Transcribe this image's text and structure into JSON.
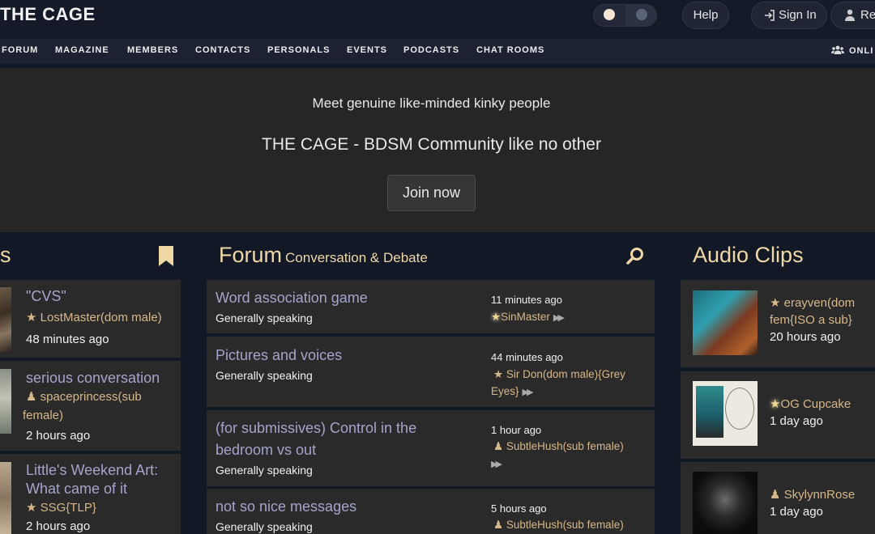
{
  "header": {
    "logo": "THE CAGE",
    "help_label": "Help",
    "signin_label": "Sign In",
    "register_label": "Re"
  },
  "nav": {
    "items": [
      "FORUM",
      "MAGAZINE",
      "MEMBERS",
      "CONTACTS",
      "PERSONALS",
      "EVENTS",
      "PODCASTS",
      "CHAT ROOMS"
    ],
    "online_label": "ONLI"
  },
  "hero": {
    "tagline": "Meet genuine like-minded kinky people",
    "title": "THE CAGE - BDSM Community like no other",
    "join_label": "Join now"
  },
  "left_section": {
    "title_fragment": "s",
    "entries": [
      {
        "title": "\"CVS\"",
        "user": "LostMaster(dom male)",
        "user_icon": "star",
        "time": "48 minutes ago"
      },
      {
        "title": "serious conversation",
        "user": "spaceprincess(sub female)",
        "user_icon": "person",
        "time": "2 hours ago"
      },
      {
        "title": "Little's Weekend Art: What came of it",
        "user": "SSG{TLP}",
        "user_icon": "star",
        "time": "2 hours ago"
      }
    ]
  },
  "forum": {
    "title": "Forum",
    "subtitle": "Conversation & Debate",
    "rows": [
      {
        "title": "Word association game",
        "category": "Generally speaking",
        "time": "11 minutes ago",
        "user": "SinMaster",
        "user_icon": "glow-star"
      },
      {
        "title": "Pictures and voices",
        "category": "Generally speaking",
        "time": "44 minutes ago",
        "user": "Sir Don(dom male){Grey Eyes}",
        "user_icon": "star"
      },
      {
        "title": "(for submissives) Control in the bedroom vs out",
        "category": "Generally speaking",
        "time": "1 hour ago",
        "user": "SubtleHush(sub female)",
        "user_icon": "person"
      },
      {
        "title": "not so nice messages",
        "category": "Generally speaking",
        "time": "5 hours ago",
        "user": "SubtleHush(sub female)",
        "user_icon": "person"
      }
    ]
  },
  "audio": {
    "title": "Audio Clips",
    "clips": [
      {
        "user": "erayven(dom fem{ISO a sub}",
        "user_icon": "star",
        "time": "20 hours ago"
      },
      {
        "user": "OG Cupcake",
        "user_icon": "glow-star",
        "time": "1 day ago"
      },
      {
        "user": "SkylynnRose",
        "user_icon": "person",
        "time": "1 day ago"
      }
    ]
  },
  "colors": {
    "accent": "#efd7a6",
    "link": "#a5a4cc",
    "username": "#d7b88a",
    "background": "#121826",
    "card": "#2a2a2a"
  }
}
